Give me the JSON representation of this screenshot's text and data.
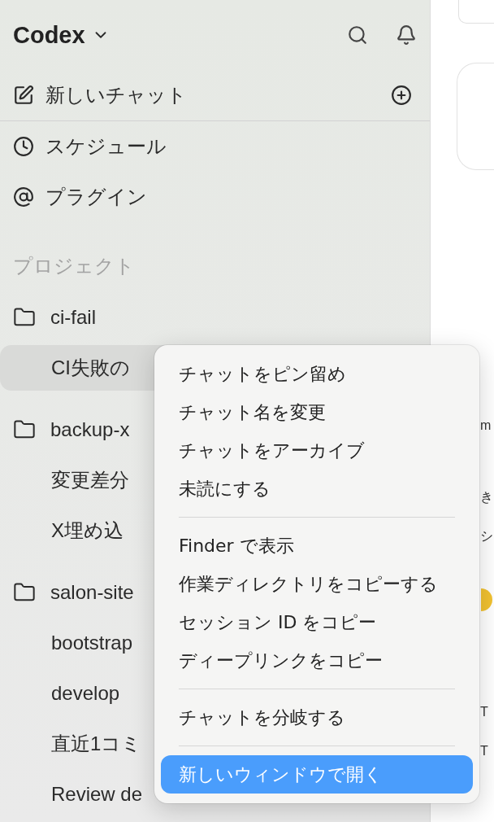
{
  "app": {
    "title": "Codex"
  },
  "nav": [
    {
      "label": "新しいチャット",
      "kind": "new"
    },
    {
      "label": "スケジュール",
      "kind": "clock"
    },
    {
      "label": "プラグイン",
      "kind": "plugin"
    }
  ],
  "section_title": "プロジェクト",
  "projects": [
    {
      "name": "ci-fail",
      "chats": [
        {
          "title": "CI失敗の",
          "selected": true
        }
      ]
    },
    {
      "name": "backup-x",
      "chats": [
        {
          "title": "変更差分",
          "selected": false
        },
        {
          "title": "X埋め込",
          "selected": false
        }
      ]
    },
    {
      "name": "salon-site",
      "chats": [
        {
          "title": "bootstrap",
          "selected": false
        },
        {
          "title": "develop",
          "selected": false
        },
        {
          "title": "直近1コミ",
          "selected": false
        },
        {
          "title": "Review de",
          "selected": false
        }
      ]
    }
  ],
  "context_menu": {
    "groups": [
      [
        {
          "label": "チャットをピン留め",
          "selected": false
        },
        {
          "label": "チャット名を変更",
          "selected": false
        },
        {
          "label": "チャットをアーカイブ",
          "selected": false
        },
        {
          "label": "未読にする",
          "selected": false
        }
      ],
      [
        {
          "label": "Finder で表示",
          "selected": false
        },
        {
          "label": "作業ディレクトリをコピーする",
          "selected": false
        },
        {
          "label": "セッション ID をコピー",
          "selected": false
        },
        {
          "label": "ディープリンクをコピー",
          "selected": false
        }
      ],
      [
        {
          "label": "チャットを分岐する",
          "selected": false
        }
      ],
      [
        {
          "label": "新しいウィンドウで開く",
          "selected": true
        }
      ]
    ]
  },
  "right_pane": {
    "fragments": [
      "m",
      "き",
      "シ",
      "T",
      "T"
    ]
  }
}
